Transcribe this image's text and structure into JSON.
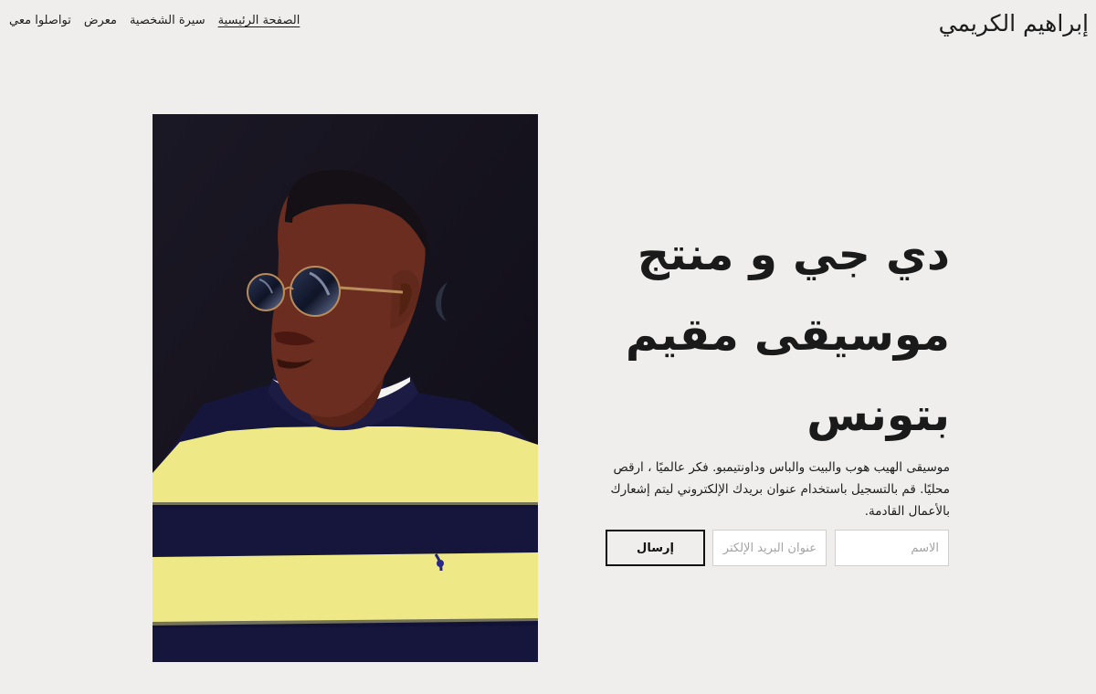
{
  "site": {
    "title": "إبراهيم الكريمي"
  },
  "nav": {
    "items": [
      {
        "label": "الصفحة الرئيسية",
        "active": true
      },
      {
        "label": "سيرة الشخصية",
        "active": false
      },
      {
        "label": "معرض",
        "active": false
      },
      {
        "label": "تواصلوا معي",
        "active": false
      }
    ]
  },
  "hero": {
    "headline_lines": [
      "دي جي و منتج",
      "موسيقى مقيم",
      "بتونس"
    ],
    "description": "موسيقى الهيب هوب والبيت والباس وداونتيمبو. فكر عالميًا ، ارقص محليًا. قم بالتسجيل باستخدام عنوان بريدك الإلكتروني ليتم إشعارك بالأعمال القادمة."
  },
  "form": {
    "name_placeholder": "الاسم",
    "email_placeholder": "عنوان البريد الإلكتروني",
    "submit_label": "إرسال"
  },
  "image": {
    "alt": "Portrait of a man wearing round sunglasses and a striped sweater",
    "colors": {
      "background": "#17141f",
      "sweater_navy": "#16163d",
      "sweater_yellow": "#eee887",
      "skin": "#6b2d1f"
    }
  }
}
